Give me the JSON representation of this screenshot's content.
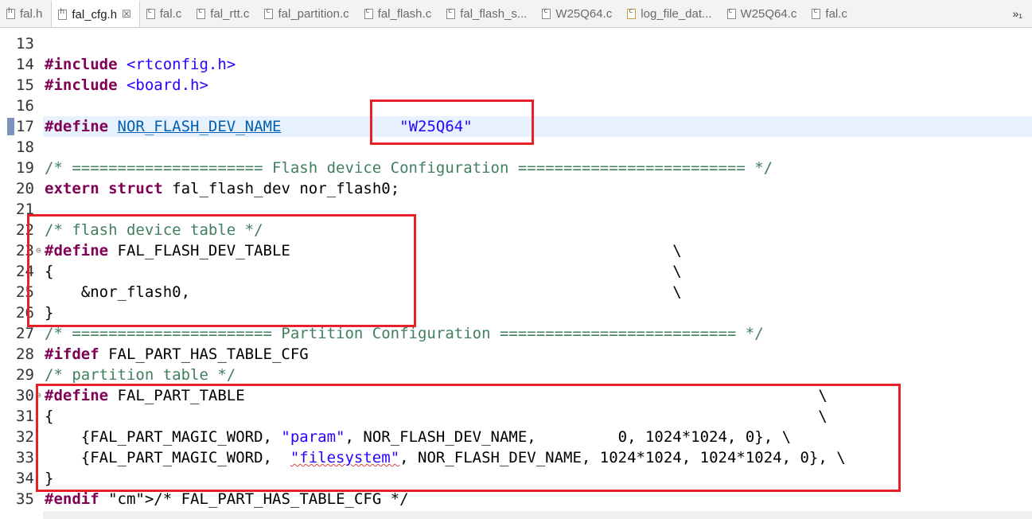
{
  "tabs": [
    {
      "label": "fal.h",
      "kind": "hdr",
      "active": false
    },
    {
      "label": "fal_cfg.h",
      "kind": "hdr",
      "active": true,
      "close": "☒"
    },
    {
      "label": "fal.c",
      "kind": "src",
      "active": false
    },
    {
      "label": "fal_rtt.c",
      "kind": "src",
      "active": false
    },
    {
      "label": "fal_partition.c",
      "kind": "src",
      "active": false
    },
    {
      "label": "fal_flash.c",
      "kind": "src",
      "active": false
    },
    {
      "label": "fal_flash_s...",
      "kind": "src",
      "active": false
    },
    {
      "label": "W25Q64.c",
      "kind": "src",
      "active": false
    },
    {
      "label": "log_file_dat...",
      "kind": "log",
      "active": false
    },
    {
      "label": "W25Q64.c",
      "kind": "src",
      "active": false
    },
    {
      "label": "fal.c",
      "kind": "src",
      "active": false
    }
  ],
  "overflow_label": "»₁",
  "code_lines": [
    {
      "num": "13",
      "text": ""
    },
    {
      "num": "14",
      "text": "#include <rtconfig.h>"
    },
    {
      "num": "15",
      "text": "#include <board.h>"
    },
    {
      "num": "16",
      "text": ""
    },
    {
      "num": "17",
      "text": "#define NOR_FLASH_DEV_NAME             \"W25Q64\""
    },
    {
      "num": "18",
      "text": ""
    },
    {
      "num": "19",
      "text": "/* ===================== Flash device Configuration ========================= */"
    },
    {
      "num": "20",
      "text": "extern struct fal_flash_dev nor_flash0;"
    },
    {
      "num": "21",
      "text": ""
    },
    {
      "num": "22",
      "text": "/* flash device table */"
    },
    {
      "num": "23",
      "text": "#define FAL_FLASH_DEV_TABLE                                          \\"
    },
    {
      "num": "24",
      "text": "{                                                                    \\"
    },
    {
      "num": "25",
      "text": "    &nor_flash0,                                                     \\"
    },
    {
      "num": "26",
      "text": "}"
    },
    {
      "num": "27",
      "text": "/* ====================== Partition Configuration ========================== */"
    },
    {
      "num": "28",
      "text": "#ifdef FAL_PART_HAS_TABLE_CFG"
    },
    {
      "num": "29",
      "text": "/* partition table */"
    },
    {
      "num": "30",
      "text": "#define FAL_PART_TABLE                                                               \\"
    },
    {
      "num": "31",
      "text": "{                                                                                    \\"
    },
    {
      "num": "32",
      "text": "    {FAL_PART_MAGIC_WORD, \"param\", NOR_FLASH_DEV_NAME,         0, 1024*1024, 0}, \\"
    },
    {
      "num": "33",
      "text": "    {FAL_PART_MAGIC_WORD,  \"filesystem\", NOR_FLASH_DEV_NAME, 1024*1024, 1024*1024, 0}, \\"
    },
    {
      "num": "34",
      "text": "}"
    },
    {
      "num": "35",
      "text": "#endif /* FAL_PART_HAS_TABLE_CFG */"
    }
  ],
  "colors": {
    "highlight_box": "#e8202a",
    "keyword": "#7f0055",
    "string": "#2a00ff",
    "comment": "#3f7f5f",
    "current_line": "#e8f2fe"
  }
}
